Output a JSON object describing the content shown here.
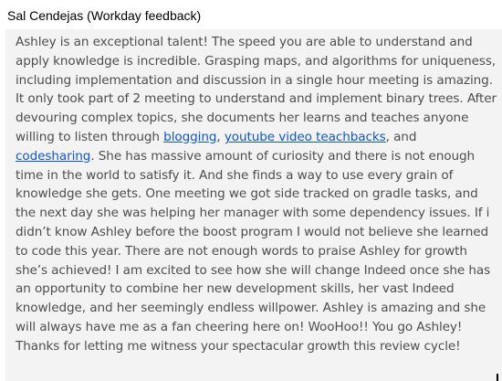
{
  "header": {
    "title": "Sal Cendejas (Workday feedback)"
  },
  "feedback": {
    "part1": "Ashley is an exceptional talent! The speed you are able to understand and apply knowledge is incredible. Grasping maps, and algorithms for uniqueness, including implementation and discussion in a single hour meeting is amazing. It only took part of 2 meeting to understand and implement binary trees. After devouring complex topics, she documents her learns and teaches anyone willing to listen through ",
    "link_blogging": "blogging",
    "sep1": ", ",
    "link_youtube": "youtube video teachbacks",
    "sep2": ", and ",
    "link_codesharing": "codesharing",
    "part2": ". She has massive amount of curiosity and there is not enough time in the world to satisfy it. And she finds a way to use every grain of knowledge she gets. One meeting we got side tracked on gradle tasks, and the next day she was helping her manager with some dependency issues. If i didn’t know Ashley before the boost program I would not believe she learned to code this year. There are not enough words to praise Ashley for growth she’s achieved! I am excited to see how she will change Indeed once she has an opportunity to combine her new development skills, her vast Indeed knowledge, and her seemingly endless willpower. Ashley is amazing and she will always have me as a fan cheering here on! WooHoo!! You go Ashley! Thanks for letting me witness your spectacular growth this review cycle!"
  }
}
